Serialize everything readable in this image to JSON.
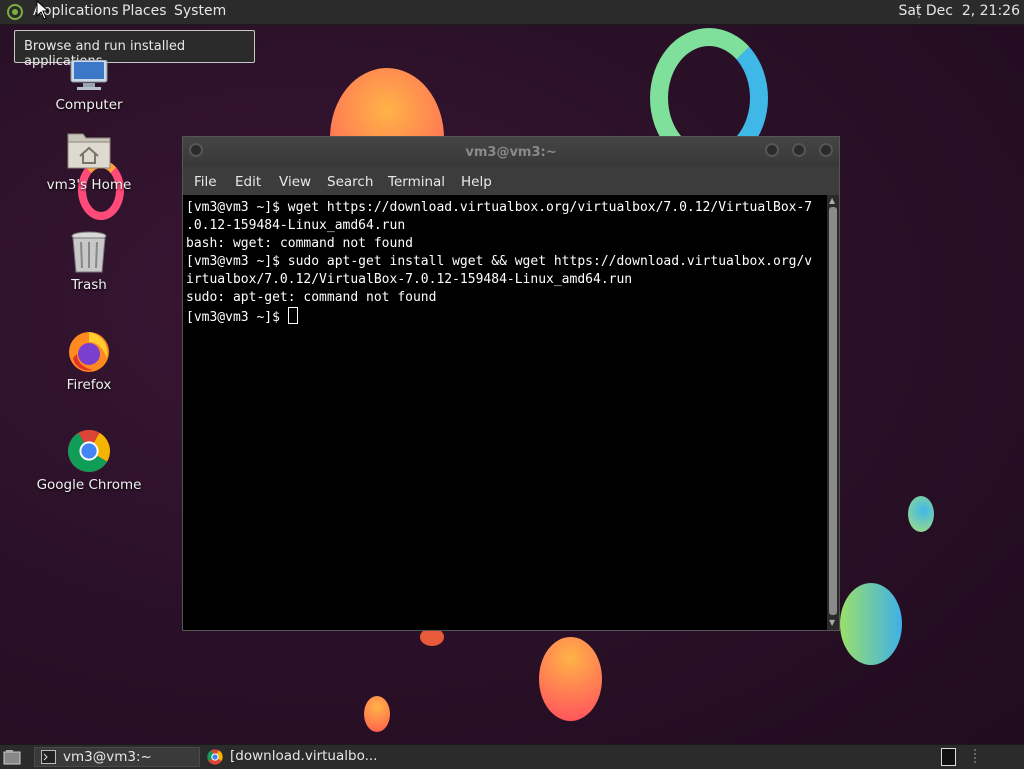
{
  "top_panel": {
    "menus": [
      "Applications",
      "Places",
      "System"
    ],
    "clock": "Sat Dec  2, 21:26"
  },
  "tooltip": {
    "text": "Browse and run installed applications"
  },
  "desktop_icons": [
    {
      "label": "Computer",
      "icon": "computer-icon"
    },
    {
      "label": "vm3's Home",
      "icon": "home-folder-icon"
    },
    {
      "label": "Trash",
      "icon": "trash-icon"
    },
    {
      "label": "Firefox",
      "icon": "firefox-icon"
    },
    {
      "label": "Google Chrome",
      "icon": "chrome-icon"
    }
  ],
  "terminal": {
    "title": "vm3@vm3:~",
    "menus": [
      "File",
      "Edit",
      "View",
      "Search",
      "Terminal",
      "Help"
    ],
    "lines": [
      "[vm3@vm3 ~]$ wget https://download.virtualbox.org/virtualbox/7.0.12/VirtualBox-7",
      ".0.12-159484-Linux_amd64.run",
      "bash: wget: command not found",
      "[vm3@vm3 ~]$ sudo apt-get install wget && wget https://download.virtualbox.org/v",
      "irtualbox/7.0.12/VirtualBox-7.0.12-159484-Linux_amd64.run",
      "sudo: apt-get: command not found"
    ],
    "prompt": "[vm3@vm3 ~]$ "
  },
  "taskbar": {
    "tasks": [
      {
        "label": "vm3@vm3:~",
        "icon": "terminal-icon"
      },
      {
        "label": "[download.virtualbo...",
        "icon": "chrome-icon"
      }
    ]
  },
  "colors": {
    "desktop_bg": "#2b1128",
    "panel_bg": "#2b2b2b",
    "terminal_bg": "#000000"
  }
}
